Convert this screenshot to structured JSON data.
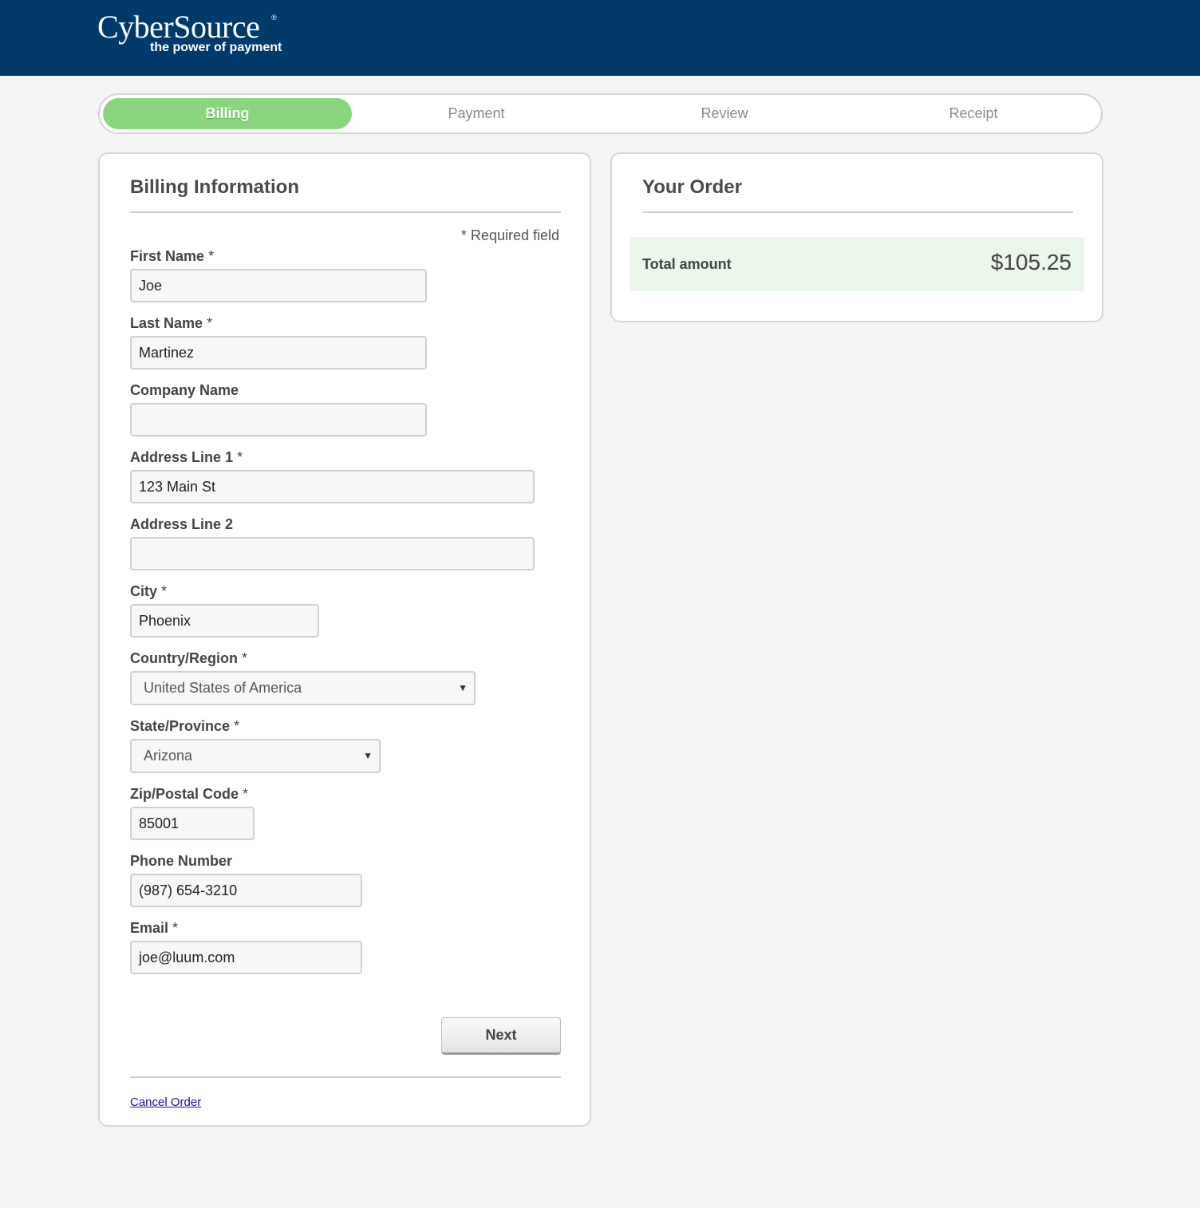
{
  "header": {
    "brand": "CyberSource",
    "registered_mark": "®",
    "tagline": "the power of payment",
    "background_color": "#003a6b"
  },
  "steps": {
    "items": [
      {
        "label": "Billing",
        "active": true
      },
      {
        "label": "Payment",
        "active": false
      },
      {
        "label": "Review",
        "active": false
      },
      {
        "label": "Receipt",
        "active": false
      }
    ],
    "active_color": "#8ad67e"
  },
  "billing": {
    "title": "Billing Information",
    "required_note": "* Required field",
    "fields": {
      "first_name": {
        "label": "First Name",
        "required_mark": "*",
        "value": "Joe"
      },
      "last_name": {
        "label": "Last Name",
        "required_mark": "*",
        "value": "Martinez"
      },
      "company_name": {
        "label": "Company Name",
        "value": ""
      },
      "address1": {
        "label": "Address Line 1",
        "required_mark": "*",
        "value": "123 Main St"
      },
      "address2": {
        "label": "Address Line 2",
        "value": ""
      },
      "city": {
        "label": "City",
        "required_mark": "*",
        "value": "Phoenix"
      },
      "country": {
        "label": "Country/Region",
        "required_mark": "*",
        "value": "United States of America"
      },
      "state": {
        "label": "State/Province",
        "required_mark": "*",
        "value": "Arizona"
      },
      "zip": {
        "label": "Zip/Postal Code",
        "required_mark": "*",
        "value": "85001"
      },
      "phone": {
        "label": "Phone Number",
        "value": "(987) 654-3210"
      },
      "email": {
        "label": "Email",
        "required_mark": "*",
        "value": "joe@luum.com"
      }
    },
    "next_label": "Next",
    "cancel_label": "Cancel Order"
  },
  "order": {
    "title": "Your Order",
    "total_label": "Total amount",
    "total_value": "$105.25"
  }
}
